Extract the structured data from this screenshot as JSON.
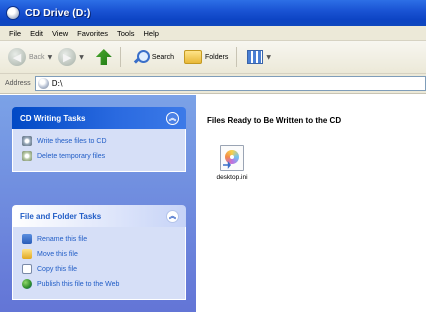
{
  "window": {
    "title": "CD Drive (D:)"
  },
  "menu": [
    "File",
    "Edit",
    "View",
    "Favorites",
    "Tools",
    "Help"
  ],
  "toolbar": {
    "back_label": "Back",
    "search_label": "Search",
    "folders_label": "Folders"
  },
  "address": {
    "label": "Address",
    "value": "D:\\"
  },
  "tasks": {
    "cd_writing": {
      "title": "CD Writing Tasks",
      "items": [
        {
          "label": "Write these files to CD",
          "icon": "cd-write-icon"
        },
        {
          "label": "Delete temporary files",
          "icon": "delete-temp-icon"
        }
      ]
    },
    "file_folder": {
      "title": "File and Folder Tasks",
      "items": [
        {
          "label": "Rename this file",
          "icon": "rename-icon"
        },
        {
          "label": "Move this file",
          "icon": "move-icon"
        },
        {
          "label": "Copy this file",
          "icon": "copy-icon"
        },
        {
          "label": "Publish this file to the Web",
          "icon": "publish-web-icon"
        }
      ]
    }
  },
  "content": {
    "heading": "Files Ready to Be Written to the CD",
    "files": [
      {
        "name": "desktop.ini"
      }
    ]
  },
  "colors": {
    "titlebar": "#0d44c4",
    "taskpane": "#6375d6",
    "link": "#215dc6"
  }
}
